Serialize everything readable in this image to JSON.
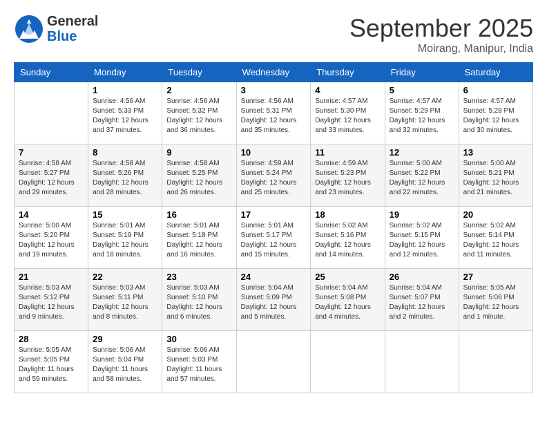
{
  "logo": {
    "general": "General",
    "blue": "Blue"
  },
  "title": "September 2025",
  "location": "Moirang, Manipur, India",
  "weekdays": [
    "Sunday",
    "Monday",
    "Tuesday",
    "Wednesday",
    "Thursday",
    "Friday",
    "Saturday"
  ],
  "weeks": [
    [
      {
        "day": "",
        "sunrise": "",
        "sunset": "",
        "daylight": ""
      },
      {
        "day": "1",
        "sunrise": "Sunrise: 4:56 AM",
        "sunset": "Sunset: 5:33 PM",
        "daylight": "Daylight: 12 hours and 37 minutes."
      },
      {
        "day": "2",
        "sunrise": "Sunrise: 4:56 AM",
        "sunset": "Sunset: 5:32 PM",
        "daylight": "Daylight: 12 hours and 36 minutes."
      },
      {
        "day": "3",
        "sunrise": "Sunrise: 4:56 AM",
        "sunset": "Sunset: 5:31 PM",
        "daylight": "Daylight: 12 hours and 35 minutes."
      },
      {
        "day": "4",
        "sunrise": "Sunrise: 4:57 AM",
        "sunset": "Sunset: 5:30 PM",
        "daylight": "Daylight: 12 hours and 33 minutes."
      },
      {
        "day": "5",
        "sunrise": "Sunrise: 4:57 AM",
        "sunset": "Sunset: 5:29 PM",
        "daylight": "Daylight: 12 hours and 32 minutes."
      },
      {
        "day": "6",
        "sunrise": "Sunrise: 4:57 AM",
        "sunset": "Sunset: 5:28 PM",
        "daylight": "Daylight: 12 hours and 30 minutes."
      }
    ],
    [
      {
        "day": "7",
        "sunrise": "Sunrise: 4:58 AM",
        "sunset": "Sunset: 5:27 PM",
        "daylight": "Daylight: 12 hours and 29 minutes."
      },
      {
        "day": "8",
        "sunrise": "Sunrise: 4:58 AM",
        "sunset": "Sunset: 5:26 PM",
        "daylight": "Daylight: 12 hours and 28 minutes."
      },
      {
        "day": "9",
        "sunrise": "Sunrise: 4:58 AM",
        "sunset": "Sunset: 5:25 PM",
        "daylight": "Daylight: 12 hours and 26 minutes."
      },
      {
        "day": "10",
        "sunrise": "Sunrise: 4:59 AM",
        "sunset": "Sunset: 5:24 PM",
        "daylight": "Daylight: 12 hours and 25 minutes."
      },
      {
        "day": "11",
        "sunrise": "Sunrise: 4:59 AM",
        "sunset": "Sunset: 5:23 PM",
        "daylight": "Daylight: 12 hours and 23 minutes."
      },
      {
        "day": "12",
        "sunrise": "Sunrise: 5:00 AM",
        "sunset": "Sunset: 5:22 PM",
        "daylight": "Daylight: 12 hours and 22 minutes."
      },
      {
        "day": "13",
        "sunrise": "Sunrise: 5:00 AM",
        "sunset": "Sunset: 5:21 PM",
        "daylight": "Daylight: 12 hours and 21 minutes."
      }
    ],
    [
      {
        "day": "14",
        "sunrise": "Sunrise: 5:00 AM",
        "sunset": "Sunset: 5:20 PM",
        "daylight": "Daylight: 12 hours and 19 minutes."
      },
      {
        "day": "15",
        "sunrise": "Sunrise: 5:01 AM",
        "sunset": "Sunset: 5:19 PM",
        "daylight": "Daylight: 12 hours and 18 minutes."
      },
      {
        "day": "16",
        "sunrise": "Sunrise: 5:01 AM",
        "sunset": "Sunset: 5:18 PM",
        "daylight": "Daylight: 12 hours and 16 minutes."
      },
      {
        "day": "17",
        "sunrise": "Sunrise: 5:01 AM",
        "sunset": "Sunset: 5:17 PM",
        "daylight": "Daylight: 12 hours and 15 minutes."
      },
      {
        "day": "18",
        "sunrise": "Sunrise: 5:02 AM",
        "sunset": "Sunset: 5:16 PM",
        "daylight": "Daylight: 12 hours and 14 minutes."
      },
      {
        "day": "19",
        "sunrise": "Sunrise: 5:02 AM",
        "sunset": "Sunset: 5:15 PM",
        "daylight": "Daylight: 12 hours and 12 minutes."
      },
      {
        "day": "20",
        "sunrise": "Sunrise: 5:02 AM",
        "sunset": "Sunset: 5:14 PM",
        "daylight": "Daylight: 12 hours and 11 minutes."
      }
    ],
    [
      {
        "day": "21",
        "sunrise": "Sunrise: 5:03 AM",
        "sunset": "Sunset: 5:12 PM",
        "daylight": "Daylight: 12 hours and 9 minutes."
      },
      {
        "day": "22",
        "sunrise": "Sunrise: 5:03 AM",
        "sunset": "Sunset: 5:11 PM",
        "daylight": "Daylight: 12 hours and 8 minutes."
      },
      {
        "day": "23",
        "sunrise": "Sunrise: 5:03 AM",
        "sunset": "Sunset: 5:10 PM",
        "daylight": "Daylight: 12 hours and 6 minutes."
      },
      {
        "day": "24",
        "sunrise": "Sunrise: 5:04 AM",
        "sunset": "Sunset: 5:09 PM",
        "daylight": "Daylight: 12 hours and 5 minutes."
      },
      {
        "day": "25",
        "sunrise": "Sunrise: 5:04 AM",
        "sunset": "Sunset: 5:08 PM",
        "daylight": "Daylight: 12 hours and 4 minutes."
      },
      {
        "day": "26",
        "sunrise": "Sunrise: 5:04 AM",
        "sunset": "Sunset: 5:07 PM",
        "daylight": "Daylight: 12 hours and 2 minutes."
      },
      {
        "day": "27",
        "sunrise": "Sunrise: 5:05 AM",
        "sunset": "Sunset: 5:06 PM",
        "daylight": "Daylight: 12 hours and 1 minute."
      }
    ],
    [
      {
        "day": "28",
        "sunrise": "Sunrise: 5:05 AM",
        "sunset": "Sunset: 5:05 PM",
        "daylight": "Daylight: 11 hours and 59 minutes."
      },
      {
        "day": "29",
        "sunrise": "Sunrise: 5:06 AM",
        "sunset": "Sunset: 5:04 PM",
        "daylight": "Daylight: 11 hours and 58 minutes."
      },
      {
        "day": "30",
        "sunrise": "Sunrise: 5:06 AM",
        "sunset": "Sunset: 5:03 PM",
        "daylight": "Daylight: 11 hours and 57 minutes."
      },
      {
        "day": "",
        "sunrise": "",
        "sunset": "",
        "daylight": ""
      },
      {
        "day": "",
        "sunrise": "",
        "sunset": "",
        "daylight": ""
      },
      {
        "day": "",
        "sunrise": "",
        "sunset": "",
        "daylight": ""
      },
      {
        "day": "",
        "sunrise": "",
        "sunset": "",
        "daylight": ""
      }
    ]
  ]
}
